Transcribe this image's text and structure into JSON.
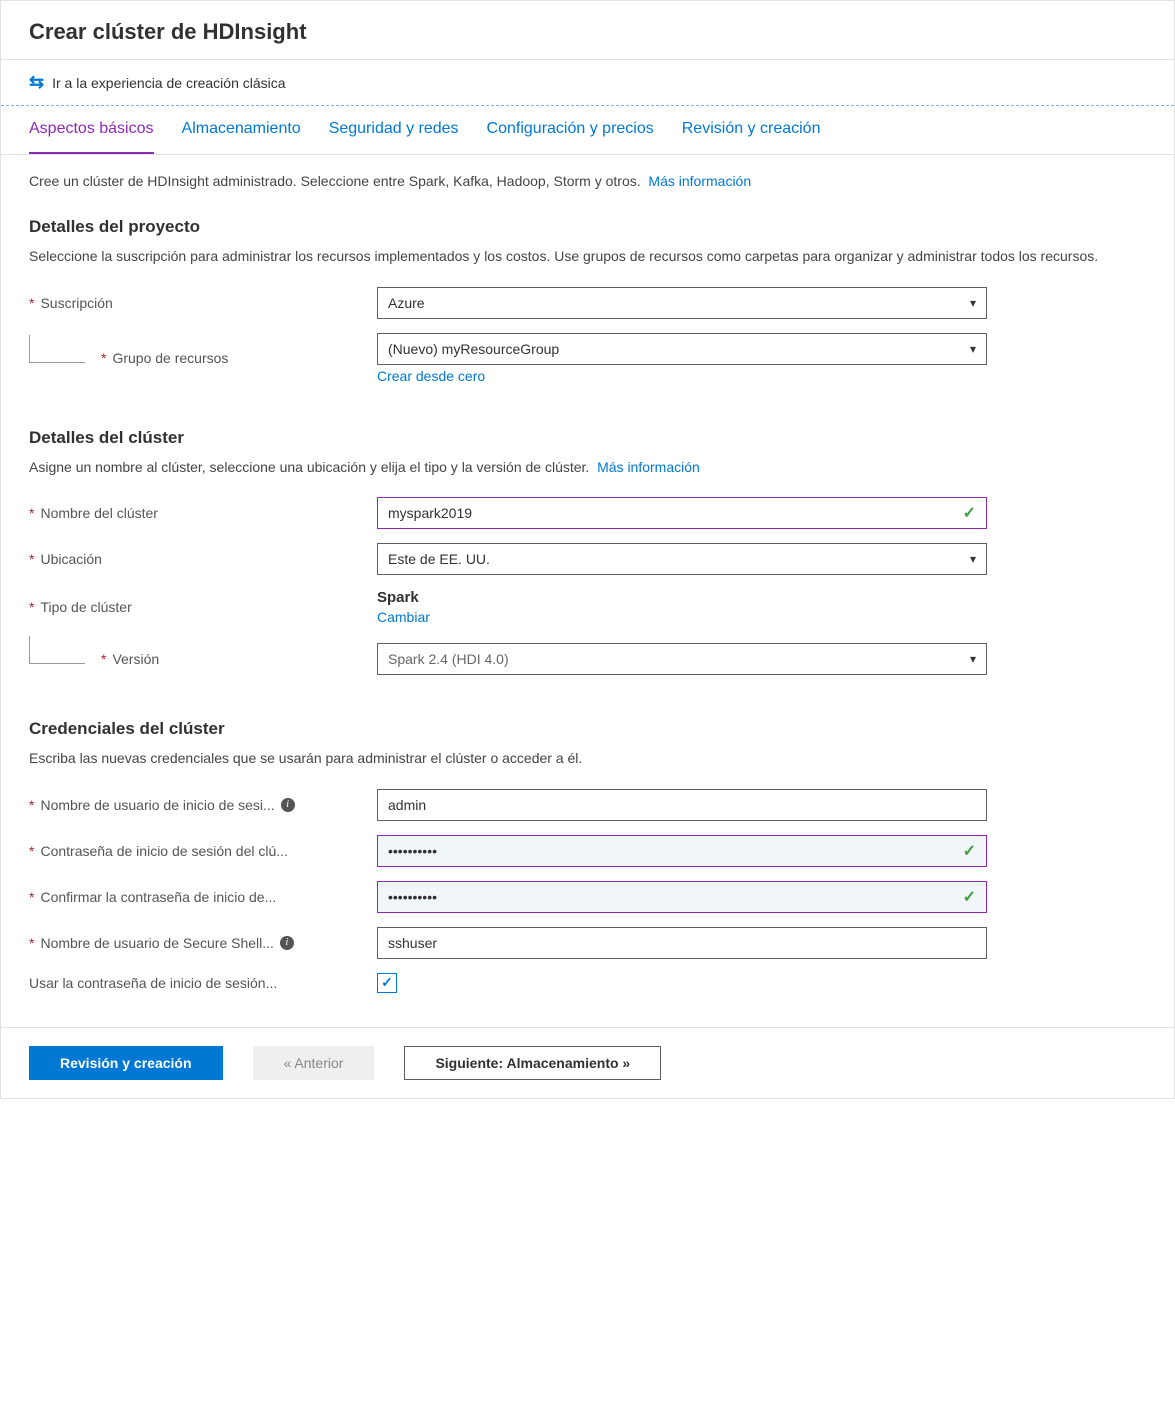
{
  "page_title": "Crear clúster de HDInsight",
  "classic_link": "Ir a la experiencia de creación clásica",
  "tabs": [
    {
      "label": "Aspectos básicos",
      "active": true
    },
    {
      "label": "Almacenamiento",
      "active": false
    },
    {
      "label": "Seguridad y redes",
      "active": false
    },
    {
      "label": "Configuración y precios",
      "active": false
    },
    {
      "label": "Revisión y creación",
      "active": false
    }
  ],
  "intro_text": "Cree un clúster de HDInsight administrado. Seleccione entre Spark, Kafka, Hadoop, Storm y otros.",
  "more_info": "Más información",
  "project": {
    "heading": "Detalles del proyecto",
    "desc": "Seleccione la suscripción para administrar los recursos implementados y los costos. Use grupos de recursos como carpetas para organizar y administrar todos los recursos.",
    "subscription_label": "Suscripción",
    "subscription_value": "Azure",
    "rg_label": "Grupo de recursos",
    "rg_value": "(Nuevo) myResourceGroup",
    "rg_create_new": "Crear desde cero"
  },
  "cluster": {
    "heading": "Detalles del clúster",
    "desc": "Asigne un nombre al clúster, seleccione una ubicación y elija el tipo y la versión de clúster.",
    "name_label": "Nombre del clúster",
    "name_value": "myspark2019",
    "location_label": "Ubicación",
    "location_value": "Este de EE. UU.",
    "type_label": "Tipo de clúster",
    "type_value": "Spark",
    "change_link": "Cambiar",
    "version_label": "Versión",
    "version_value": "Spark 2.4 (HDI 4.0)"
  },
  "creds": {
    "heading": "Credenciales del clúster",
    "desc": "Escriba las nuevas credenciales que se usarán para administrar el clúster o acceder a él.",
    "login_user_label": "Nombre de usuario de inicio de sesi...",
    "login_user_value": "admin",
    "login_pwd_label": "Contraseña de inicio de sesión del clú...",
    "login_pwd_value": "••••••••••",
    "confirm_pwd_label": "Confirmar la contraseña de inicio de...",
    "confirm_pwd_value": "••••••••••",
    "ssh_user_label": "Nombre de usuario de Secure Shell...",
    "ssh_user_value": "sshuser",
    "use_login_pwd_label": "Usar la contraseña de inicio de sesión...",
    "use_login_pwd_checked": true
  },
  "footer": {
    "review": "Revisión y creación",
    "prev": "« Anterior",
    "next": "Siguiente: Almacenamiento »"
  }
}
